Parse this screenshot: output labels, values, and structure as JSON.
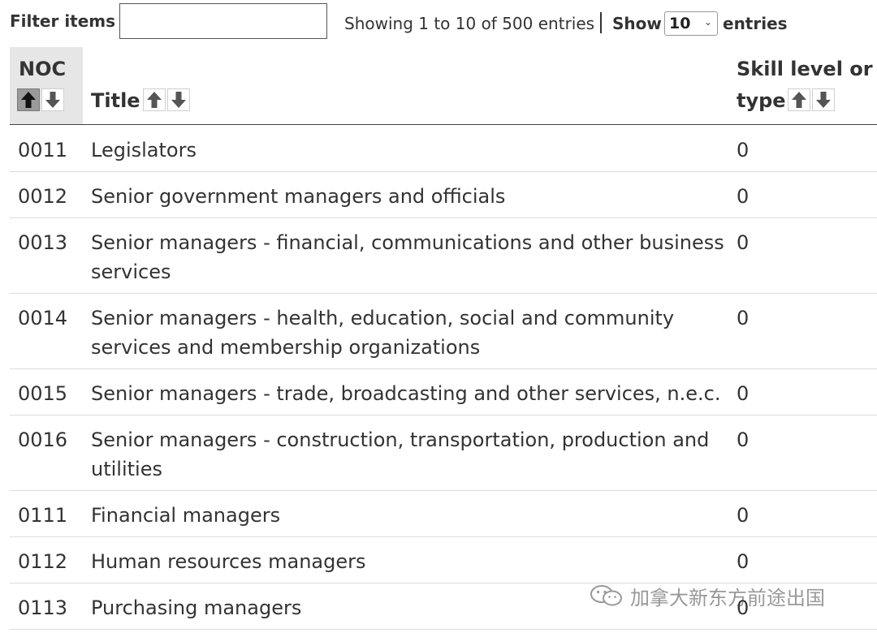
{
  "toolbar": {
    "filter_label": "Filter items",
    "filter_value": "",
    "showing_text": "Showing 1 to 10 of 500 entries",
    "show_label": "Show",
    "page_size": "10",
    "entries_label": "entries"
  },
  "columns": {
    "noc": "NOC",
    "title": "Title",
    "skill_line1": "Skill level or",
    "skill_line2": "type"
  },
  "rows": [
    {
      "noc": "0011",
      "title": "Legislators",
      "skill": "0"
    },
    {
      "noc": "0012",
      "title": "Senior government managers and officials",
      "skill": "0"
    },
    {
      "noc": "0013",
      "title": "Senior managers - financial, communications and other business services",
      "skill": "0"
    },
    {
      "noc": "0014",
      "title": "Senior managers - health, education, social and community services and membership organizations",
      "skill": "0"
    },
    {
      "noc": "0015",
      "title": "Senior managers - trade, broadcasting and other services, n.e.c.",
      "skill": "0"
    },
    {
      "noc": "0016",
      "title": "Senior managers - construction, transportation, production and utilities",
      "skill": "0"
    },
    {
      "noc": "0111",
      "title": "Financial managers",
      "skill": "0"
    },
    {
      "noc": "0112",
      "title": "Human resources managers",
      "skill": "0"
    },
    {
      "noc": "0113",
      "title": "Purchasing managers",
      "skill": "0"
    }
  ],
  "watermark": {
    "text": "加拿大新东方前途出国",
    "icon": "wechat-icon"
  },
  "colors": {
    "header_active_bg": "#e6e6e6",
    "sort_active_bg": "#9a9a9a"
  }
}
